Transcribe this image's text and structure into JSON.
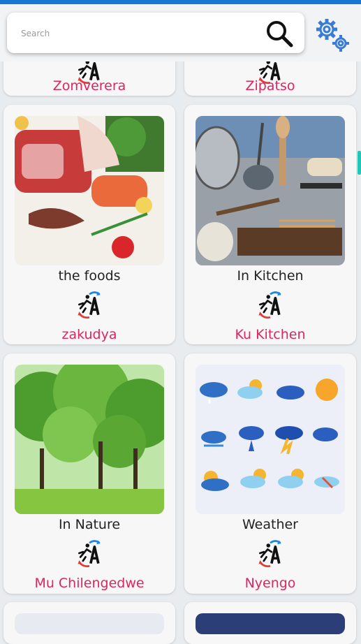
{
  "search": {
    "placeholder": "Search",
    "value": ""
  },
  "accent_color": "#e0245e",
  "cards": [
    {
      "title_en": "",
      "title_local": "Zomverera"
    },
    {
      "title_en": "",
      "title_local": "Zipatso"
    },
    {
      "title_en": "the foods",
      "title_local": "zakudya",
      "image": "raw-food-photo"
    },
    {
      "title_en": "In Kitchen",
      "title_local": "Ku Kitchen",
      "image": "kitchen-utensils-photo"
    },
    {
      "title_en": "In Nature",
      "title_local": "Mu Chilengedwe",
      "image": "green-trees-park-photo"
    },
    {
      "title_en": "Weather",
      "title_local": "Nyengo",
      "image": "weather-icons-grid"
    }
  ],
  "weather_icons": [
    "cloud-snow",
    "cloud-sun",
    "cloud",
    "sun",
    "cloud-wind",
    "cloud-rain",
    "cloud-lightning",
    "cloud-snow",
    "sun-cloud",
    "sun-cloud-rain",
    "sun-cloud-snow",
    "cloud-wind"
  ]
}
